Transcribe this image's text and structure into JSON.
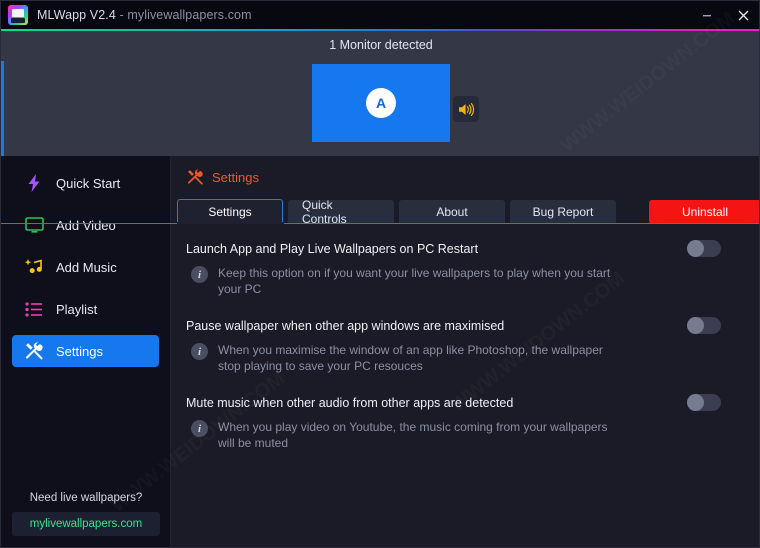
{
  "window": {
    "app_name": "MLWapp V2.4",
    "separator": " - ",
    "site": "mylivewallpapers.com",
    "minimize_label": "Minimize",
    "close_label": "Close"
  },
  "monitor_panel": {
    "label": "1 Monitor detected",
    "monitor_letter": "A",
    "sound_icon": "speaker-icon",
    "monitor_color": "#1678ef"
  },
  "sidebar": {
    "items": [
      {
        "label": "Quick Start",
        "icon": "lightning-bolt-icon",
        "active": false
      },
      {
        "label": "Add Video",
        "icon": "monitor-icon",
        "active": false
      },
      {
        "label": "Add Music",
        "icon": "music-note-sparkle-icon",
        "active": false
      },
      {
        "label": "Playlist",
        "icon": "list-icon",
        "active": false
      },
      {
        "label": "Settings",
        "icon": "tools-icon",
        "active": true
      }
    ],
    "footer_question": "Need live wallpapers?",
    "footer_link": "mylivewallpapers.com"
  },
  "main": {
    "section_title": "Settings",
    "section_icon": "tools-icon",
    "tabs": [
      {
        "label": "Settings",
        "active": true
      },
      {
        "label": "Quick Controls",
        "active": false
      },
      {
        "label": "About",
        "active": false
      },
      {
        "label": "Bug Report",
        "active": false
      }
    ],
    "uninstall_label": "Uninstall",
    "uninstall_color": "#f51414",
    "settings": [
      {
        "title": "Launch App and Play Live Wallpapers on PC Restart",
        "description": "Keep this option on if you want your live wallpapers to play when you start your PC",
        "toggle_state": "off"
      },
      {
        "title": "Pause wallpaper when other app windows are maximised",
        "description": "When you maximise the window of an app like Photoshop, the wallpaper stop playing to save your PC resouces",
        "toggle_state": "off"
      },
      {
        "title": "Mute music when other audio from other apps are detected",
        "description": "When you play video on Youtube, the music coming from your wallpapers will be muted",
        "toggle_state": "off"
      }
    ]
  }
}
